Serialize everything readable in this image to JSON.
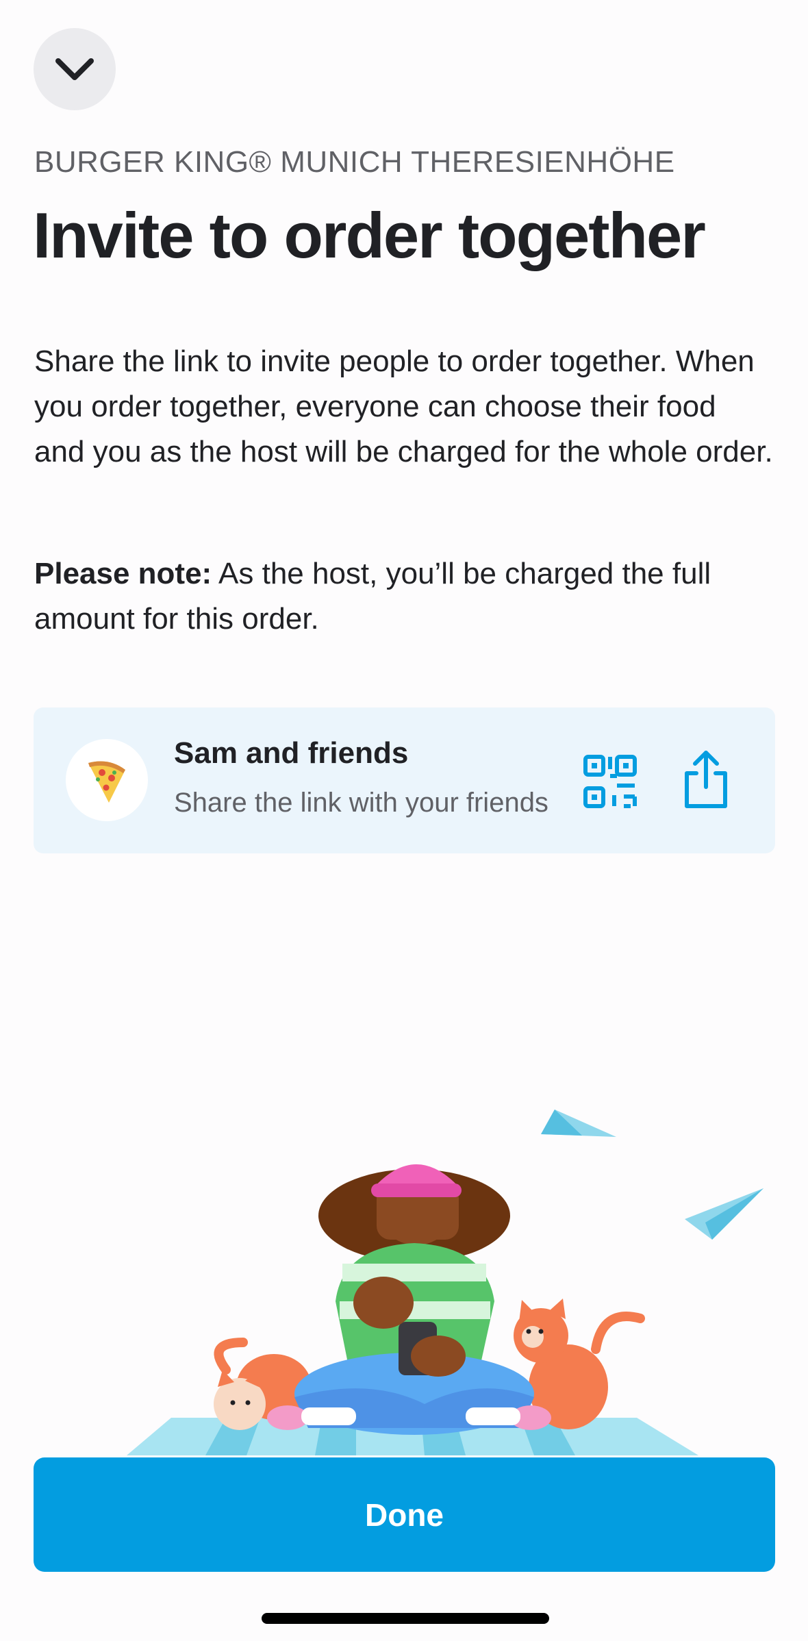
{
  "header": {
    "close_icon": "chevron-down-icon"
  },
  "venue_name": "BURGER KING® MUNICH THERESIENHÖHE",
  "title": "Invite to order together",
  "description": "Share the link to invite people to order together. When you order together, everyone can choose their food and you as the host will be charged for the whole order.",
  "note": {
    "label": "Please note:",
    "text": " As the host, you’ll be charged the full amount for this order."
  },
  "group": {
    "avatar_icon": "pizza-icon",
    "name": "Sam and friends",
    "subtitle": "Share the link with your friends",
    "qr_icon": "qr-code-icon",
    "share_icon": "share-icon"
  },
  "actions": {
    "done_label": "Done"
  },
  "colors": {
    "accent": "#039de0",
    "card_background": "#ebf5fc",
    "text_primary": "#202125",
    "text_secondary": "#606166"
  }
}
